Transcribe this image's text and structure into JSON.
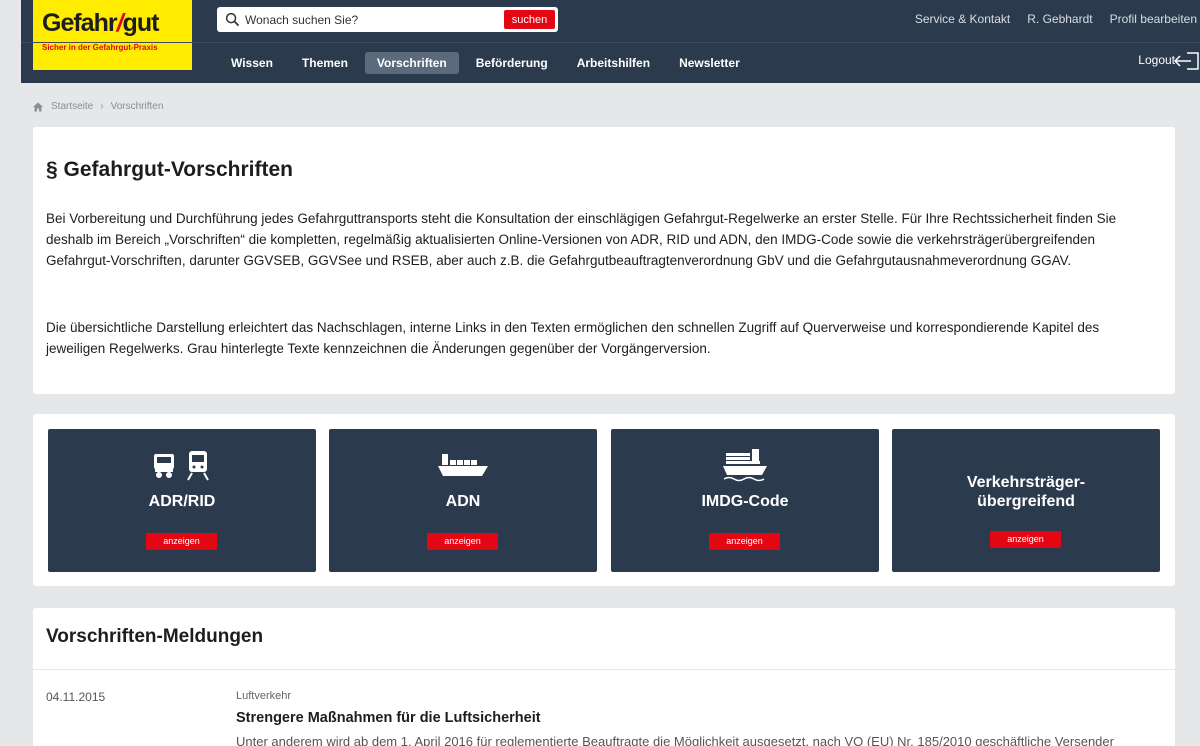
{
  "logo": {
    "word_a": "Gefahr",
    "word_slash": "/",
    "word_b": "gut",
    "tagline": "Sicher in der Gefahrgut-Praxis"
  },
  "search": {
    "placeholder": "Wonach suchen Sie?",
    "button": "suchen"
  },
  "toplinks": [
    "Service & Kontakt",
    "R. Gebhardt",
    "Profil bearbeiten"
  ],
  "nav": {
    "items": [
      "Wissen",
      "Themen",
      "Vorschriften",
      "Beförderung",
      "Arbeitshilfen",
      "Newsletter"
    ],
    "active": "Vorschriften"
  },
  "logout": "Logout",
  "breadcrumb": {
    "home": "Startseite",
    "sep": "›",
    "current": "Vorschriften"
  },
  "intro": {
    "title": "§ Gefahrgut-Vorschriften",
    "p1": "Bei Vorbereitung und Durchführung jedes Gefahrguttransports steht die Konsultation der einschlägigen Gefahrgut-Regelwerke an erster Stelle. Für Ihre Rechtssicherheit finden Sie deshalb im Bereich „Vorschriften“ die kompletten, regelmäßig aktualisierten Online-Versionen von ADR, RID und ADN, den IMDG-Code sowie die verkehrsträgerübergreifenden Gefahrgut-Vorschriften, darunter GGVSEB, GGVSee und RSEB, aber auch z.B. die Gefahrgutbeauftragtenverordnung GbV und die Gefahrgutausnahmeverordnung GGAV.",
    "p2": "Die übersichtliche Darstellung erleichtert das Nachschlagen, interne Links in den Texten ermöglichen den schnellen Zugriff auf Querverweise und korrespondierende Kapitel des jeweiligen Regelwerks. Grau hinterlegte Texte kennzeichnen die Änderungen gegenüber der Vorgängerversion."
  },
  "tiles": [
    {
      "title": "ADR/RID",
      "button": "anzeigen",
      "icon": "truck-train-icon"
    },
    {
      "title": "ADN",
      "button": "anzeigen",
      "icon": "barge-icon"
    },
    {
      "title": "IMDG-Code",
      "button": "anzeigen",
      "icon": "container-ship-icon"
    },
    {
      "title_line1": "Verkehrsträger-",
      "title_line2": "übergreifend",
      "button": "anzeigen"
    }
  ],
  "news": {
    "heading": "Vorschriften-Meldungen",
    "items": [
      {
        "date": "04.11.2015",
        "category": "Luftverkehr",
        "title": "Strengere Maßnahmen für die Luftsicherheit",
        "text": "Unter anderem wird ab dem 1. April 2016 für reglementierte Beauftragte die Möglichkeit ausgesetzt, nach VO (EU) Nr. 185/2010 geschäftliche Versender"
      }
    ]
  },
  "colors": {
    "header": "#2c3a4d",
    "accent": "#e30613",
    "logo": "#ffec00",
    "background": "#e6e7e8"
  }
}
